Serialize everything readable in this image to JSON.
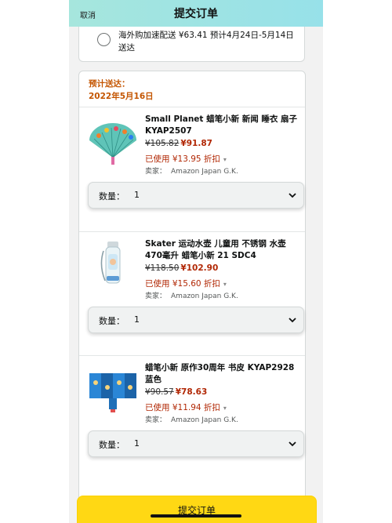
{
  "header": {
    "cancel": "取消",
    "title": "提交订单"
  },
  "shipping_option": {
    "text": "海外购加速配送 ¥63.41 预计4月24日-5月14日送达"
  },
  "estimate": {
    "label": "预计送达：",
    "date": "2022年5月16日"
  },
  "items": [
    {
      "title": "Small Planet 蜡笔小新 新闻 睡衣 扇子 KYAP2507",
      "old_price": "¥105.82",
      "new_price": "¥91.87",
      "discount": "已使用 ¥13.95 折扣",
      "seller_label": "卖家：",
      "seller": "Amazon Japan G.K.",
      "qty_label": "数量：",
      "qty_value": "1",
      "thumb": "folding-fan"
    },
    {
      "title": "Skater 运动水壶 儿童用 不锈钢 水壶 470毫升 蜡笔小新 21 SDC4",
      "old_price": "¥118.50",
      "new_price": "¥102.90",
      "discount": "已使用 ¥15.60 折扣",
      "seller_label": "卖家：",
      "seller": "Amazon Japan G.K.",
      "qty_label": "数量：",
      "qty_value": "1",
      "thumb": "water-bottle"
    },
    {
      "title": "蜡笔小新 原作30周年 书皮 KYAP2928 蓝色",
      "old_price": "¥90.57",
      "new_price": "¥78.63",
      "discount": "已使用 ¥11.94 折扣",
      "seller_label": "卖家：",
      "seller": "Amazon Japan G.K.",
      "qty_label": "数量：",
      "qty_value": "1",
      "thumb": "book-cover"
    }
  ],
  "submit": {
    "label": "提交订单"
  },
  "colors": {
    "header_gradient": [
      "#a6e6dd",
      "#97e1e9"
    ],
    "price_red": "#b12704",
    "estimate_orange": "#c45500",
    "submit_yellow": "#ffd814"
  }
}
